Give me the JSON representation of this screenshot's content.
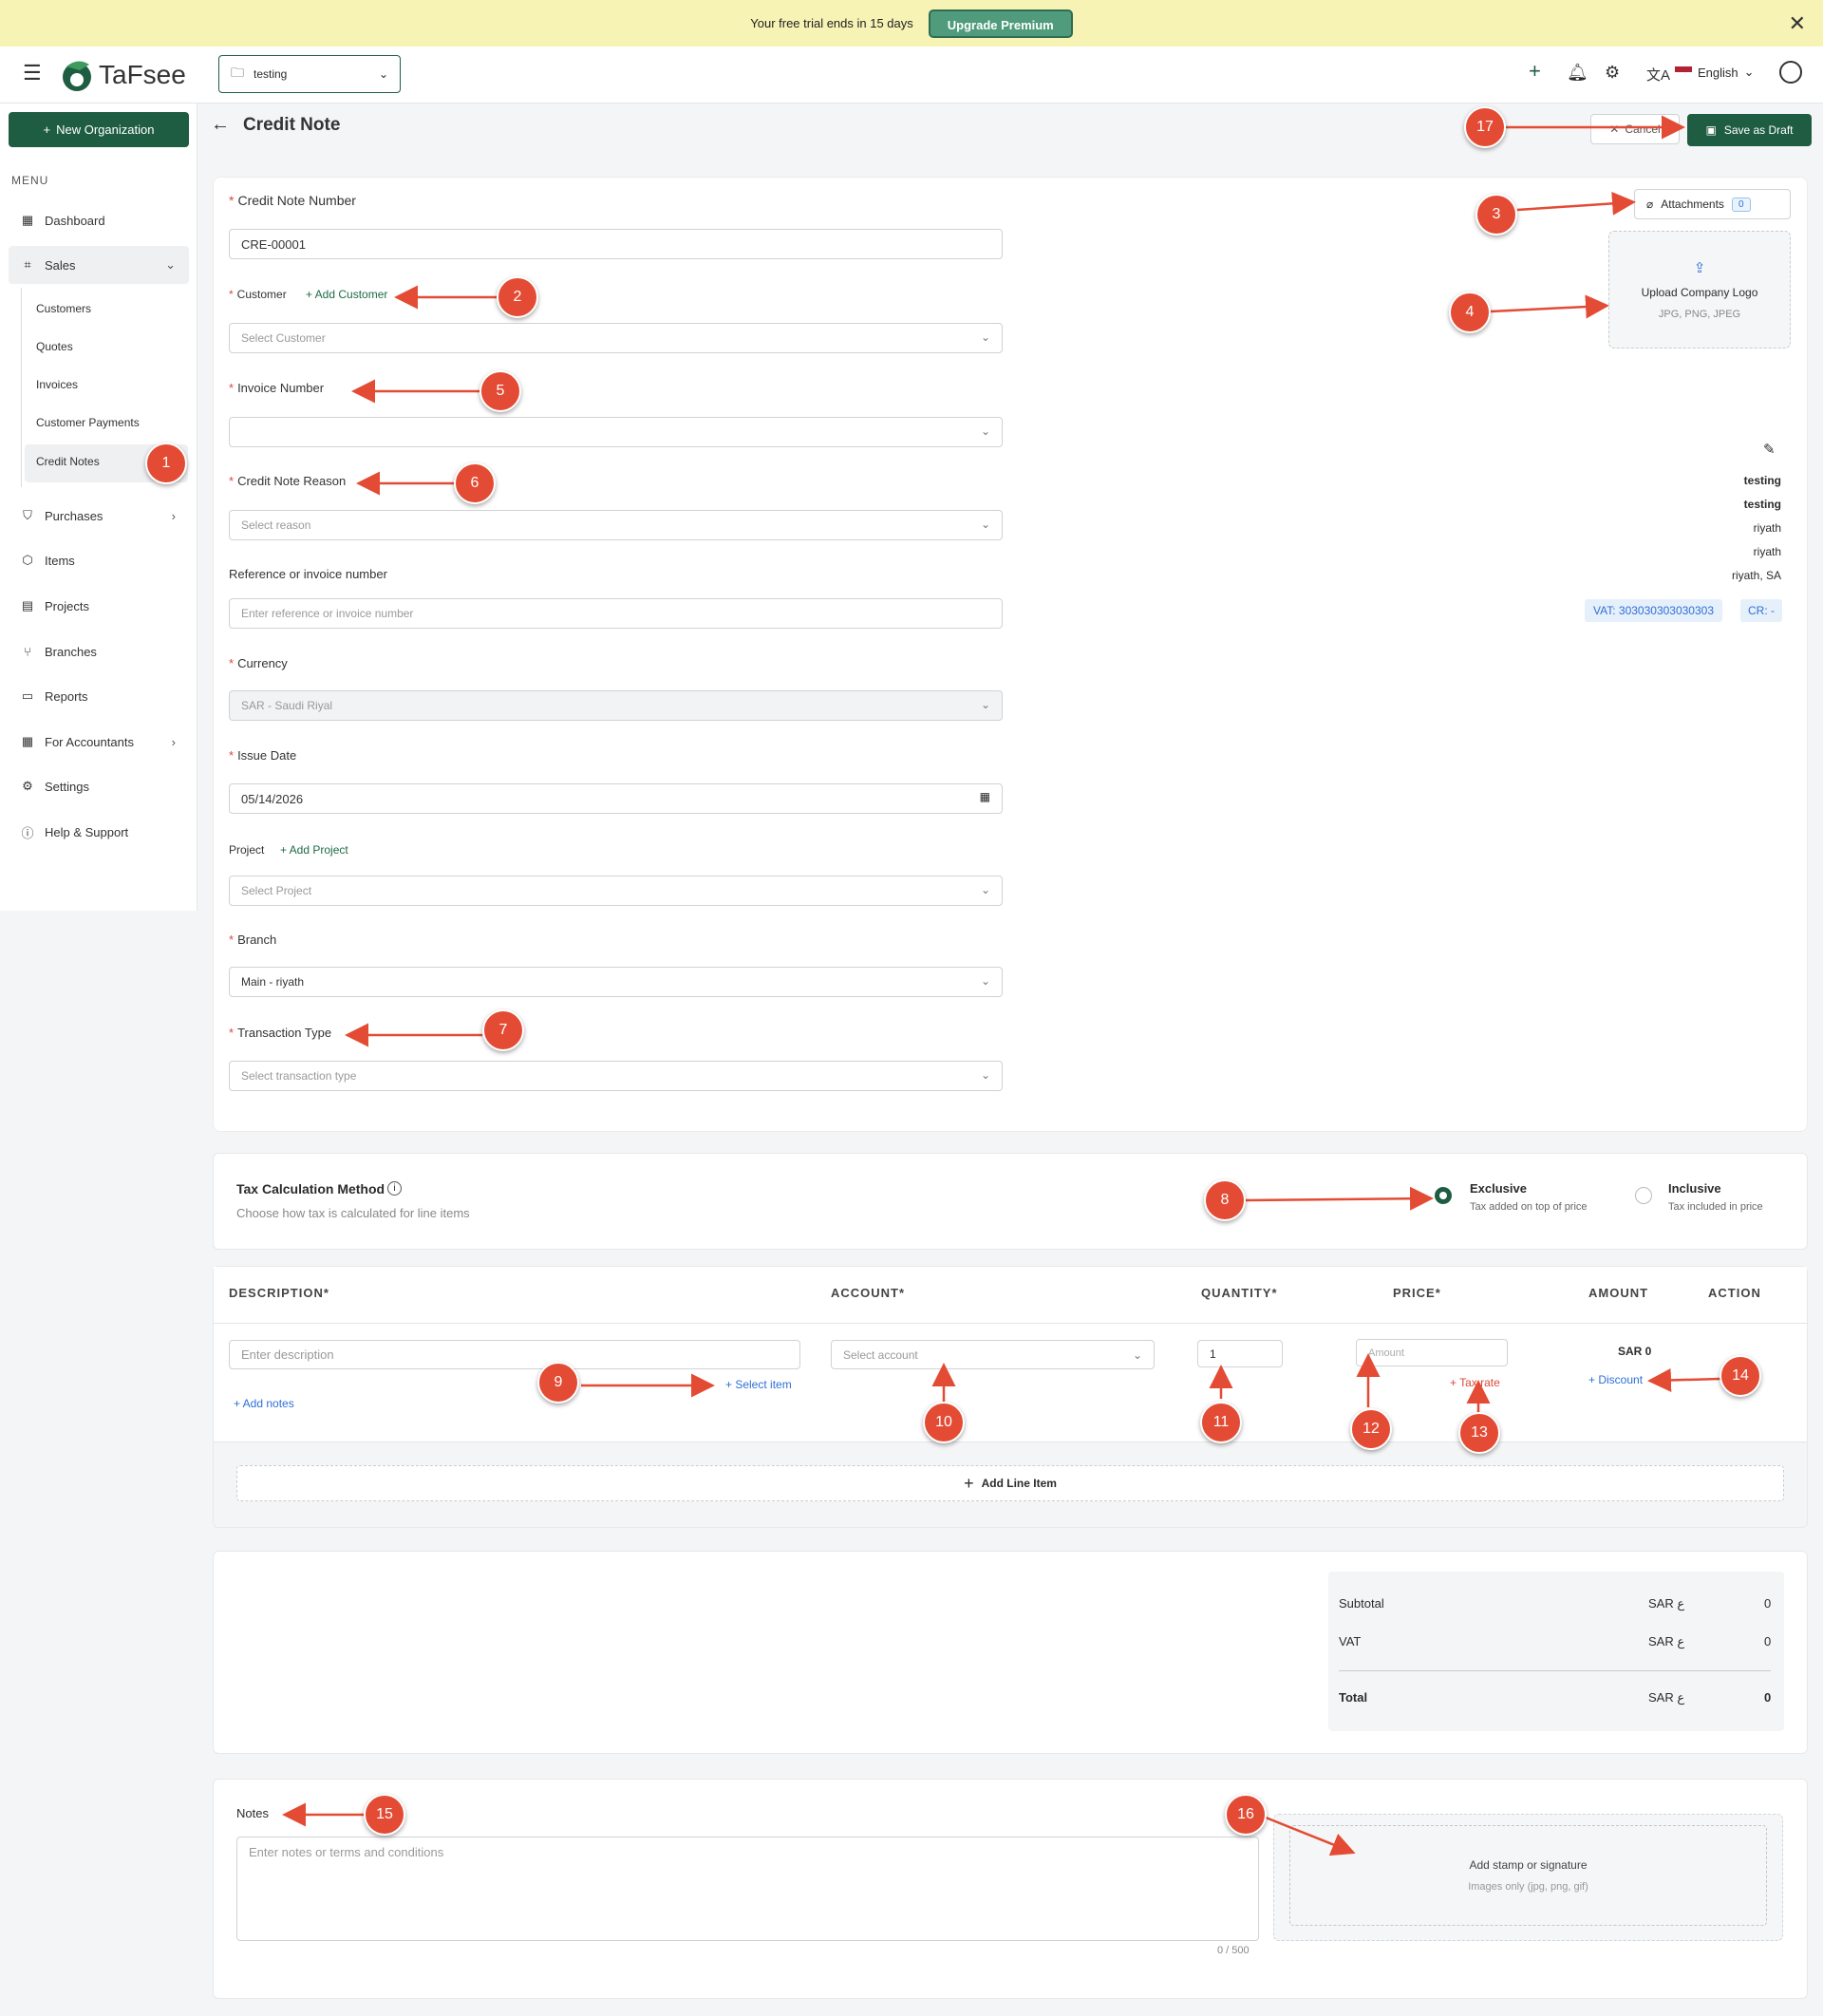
{
  "banner": {
    "text": "Your free trial ends in 15 days",
    "upgrade": "Upgrade Premium"
  },
  "topbar": {
    "logo": "TaFsee",
    "org": "testing",
    "language": "English"
  },
  "sidebar": {
    "new_org": "New Organization",
    "menu_label": "MENU",
    "items": [
      "Dashboard",
      "Sales",
      "Purchases",
      "Items",
      "Projects",
      "Branches",
      "Reports",
      "For Accountants",
      "Settings",
      "Help & Support"
    ],
    "sales_sub": [
      "Customers",
      "Quotes",
      "Invoices",
      "Customer Payments",
      "Credit Notes"
    ]
  },
  "header": {
    "title": "Credit Note",
    "cancel": "Cancel",
    "save_draft": "Save as Draft"
  },
  "form": {
    "credit_note_number_label": "Credit Note Number",
    "credit_note_number": "CRE-00001",
    "customer_label": "Customer",
    "add_customer": "+ Add Customer",
    "customer_placeholder": "Select Customer",
    "invoice_label": "Invoice Number",
    "reason_label": "Credit Note Reason",
    "reason_placeholder": "Select reason",
    "reference_label": "Reference or invoice number",
    "reference_placeholder": "Enter reference or invoice number",
    "currency_label": "Currency",
    "currency": "SAR - Saudi Riyal",
    "issue_date_label": "Issue Date",
    "issue_date": "05/14/2026",
    "project_label": "Project",
    "add_project": "+ Add Project",
    "project_placeholder": "Select Project",
    "branch_label": "Branch",
    "branch": "Main - riyath",
    "transaction_label": "Transaction Type",
    "transaction_placeholder": "Select transaction type"
  },
  "side_panel": {
    "attachments": "Attachments",
    "attachments_count": "0",
    "upload_logo": "Upload Company Logo",
    "formats": "JPG, PNG, JPEG",
    "company_lines": [
      "testing",
      "testing",
      "riyath",
      "riyath",
      "riyath, SA"
    ],
    "vat": "VAT: 303030303030303",
    "cr": "CR: -"
  },
  "tax": {
    "title": "Tax Calculation Method",
    "subtitle": "Choose how tax is calculated for line items",
    "exclusive": "Exclusive",
    "exclusive_desc": "Tax added on top of price",
    "inclusive": "Inclusive",
    "inclusive_desc": "Tax included in price"
  },
  "table": {
    "headers": [
      "DESCRIPTION*",
      "ACCOUNT*",
      "QUANTITY*",
      "PRICE*",
      "AMOUNT",
      "ACTION"
    ],
    "desc_placeholder": "Enter description",
    "select_item": "+ Select item",
    "add_notes": "+ Add notes",
    "account_placeholder": "Select account",
    "quantity": "1",
    "price_placeholder": "Amount",
    "tax_rate": "+ Tax rate",
    "amount": "SAR 0",
    "discount": "+ Discount",
    "add_line": "Add Line Item"
  },
  "totals": {
    "subtotal_label": "Subtotal",
    "vat_label": "VAT",
    "total_label": "Total",
    "currency": "SAR ع",
    "subtotal": "0",
    "vat": "0",
    "total": "0"
  },
  "notes": {
    "label": "Notes",
    "placeholder": "Enter notes or terms and conditions",
    "counter": "0 / 500",
    "stamp": "Add stamp or signature",
    "stamp_formats": "Images only (jpg, png, gif)"
  },
  "callouts": [
    "1",
    "2",
    "3",
    "4",
    "5",
    "6",
    "7",
    "8",
    "9",
    "10",
    "11",
    "12",
    "13",
    "14",
    "15",
    "16",
    "17"
  ],
  "colors": {
    "brand": "#1f5d43",
    "callout": "#e34b34",
    "banner": "#f6f3b5",
    "link": "#2e6fd6"
  }
}
